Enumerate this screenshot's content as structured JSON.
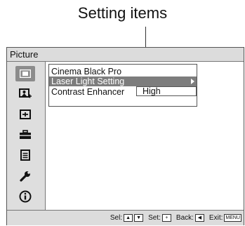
{
  "callout": {
    "label": "Setting items"
  },
  "menu": {
    "title": "Picture",
    "sidebar": [
      {
        "icon": "picture-icon",
        "active": true
      },
      {
        "icon": "picture-plus-icon",
        "active": false
      },
      {
        "icon": "screen-icon",
        "active": false
      },
      {
        "icon": "toolbox-icon",
        "active": false
      },
      {
        "icon": "list-icon",
        "active": false
      },
      {
        "icon": "wrench-icon",
        "active": false
      },
      {
        "icon": "info-icon",
        "active": false
      }
    ],
    "items": [
      {
        "label": "Cinema Black Pro"
      },
      {
        "label": "Laser Light Setting"
      },
      {
        "label": "Contrast Enhancer"
      }
    ],
    "contrast_value": "High"
  },
  "footer": {
    "sel_label": "Sel:",
    "set_label": "Set:",
    "back_label": "Back:",
    "exit_label": "Exit:",
    "menu_key": "MENU"
  }
}
